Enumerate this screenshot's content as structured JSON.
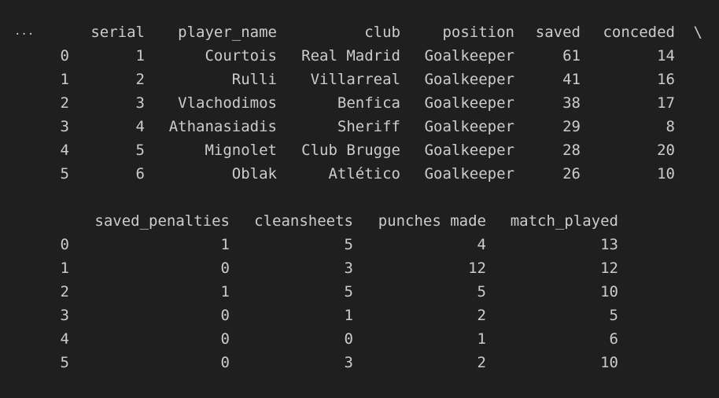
{
  "output": {
    "ellipsis": "...",
    "block1": {
      "columns": [
        "",
        "serial",
        "player_name",
        "club",
        "position",
        "saved",
        "conceded",
        "\\"
      ],
      "rows": [
        [
          "0",
          "1",
          "Courtois",
          "Real Madrid",
          "Goalkeeper",
          "61",
          "14",
          ""
        ],
        [
          "1",
          "2",
          "Rulli",
          "Villarreal",
          "Goalkeeper",
          "41",
          "16",
          ""
        ],
        [
          "2",
          "3",
          "Vlachodimos",
          "Benfica",
          "Goalkeeper",
          "38",
          "17",
          ""
        ],
        [
          "3",
          "4",
          "Athanasiadis",
          "Sheriff",
          "Goalkeeper",
          "29",
          "8",
          ""
        ],
        [
          "4",
          "5",
          "Mignolet",
          "Club Brugge",
          "Goalkeeper",
          "28",
          "20",
          ""
        ],
        [
          "5",
          "6",
          "Oblak",
          "Atlético",
          "Goalkeeper",
          "26",
          "10",
          ""
        ]
      ]
    },
    "block2": {
      "columns": [
        "",
        "saved_penalties",
        "cleansheets",
        "punches made",
        "match_played"
      ],
      "rows": [
        [
          "0",
          "1",
          "5",
          "4",
          "13"
        ],
        [
          "1",
          "0",
          "3",
          "12",
          "12"
        ],
        [
          "2",
          "1",
          "5",
          "5",
          "10"
        ],
        [
          "3",
          "0",
          "1",
          "2",
          "5"
        ],
        [
          "4",
          "0",
          "0",
          "1",
          "6"
        ],
        [
          "5",
          "0",
          "3",
          "2",
          "10"
        ]
      ]
    }
  }
}
